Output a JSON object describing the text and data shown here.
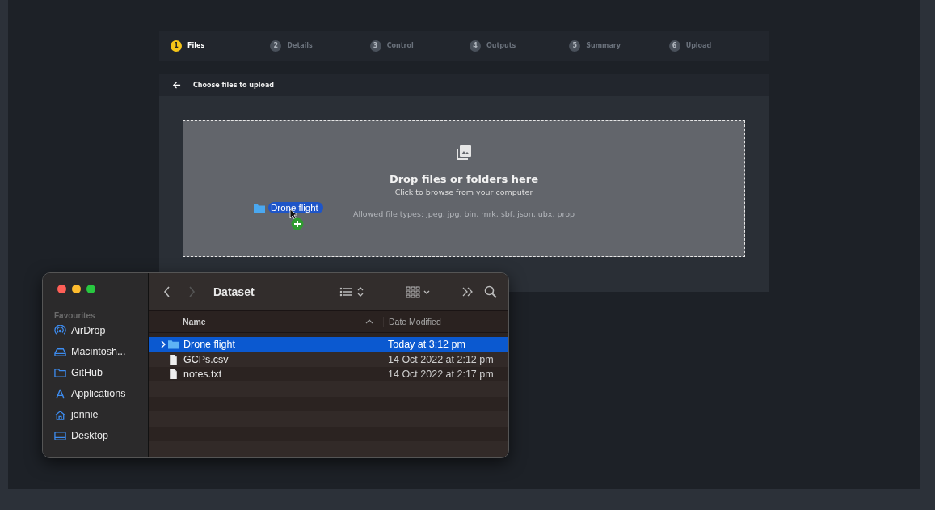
{
  "steps": [
    {
      "number": "1",
      "label": "Files",
      "selected": true
    },
    {
      "number": "2",
      "label": "Details",
      "selected": false
    },
    {
      "number": "3",
      "label": "Control",
      "selected": false
    },
    {
      "number": "4",
      "label": "Outputs",
      "selected": false
    },
    {
      "number": "5",
      "label": "Summary",
      "selected": false
    },
    {
      "number": "6",
      "label": "Upload",
      "selected": false
    }
  ],
  "header": {
    "title": "Choose files to upload"
  },
  "dropzone": {
    "title": "Drop files or folders here",
    "subtitle": "Click to browse from your computer",
    "allowed": "Allowed file types: jpeg, jpg, bin, mrk, sbf, json, ubx, prop"
  },
  "drag_item": {
    "label": "Drone flight"
  },
  "finder": {
    "title": "Dataset",
    "sidebar_heading": "Favourites",
    "sidebar_items": [
      {
        "label": "AirDrop",
        "kind": "airdrop"
      },
      {
        "label": "Macintosh...",
        "kind": "drive"
      },
      {
        "label": "GitHub",
        "kind": "folder"
      },
      {
        "label": "Applications",
        "kind": "apps"
      },
      {
        "label": "jonnie",
        "kind": "home"
      },
      {
        "label": "Desktop",
        "kind": "desktop"
      }
    ],
    "columns": [
      "Name",
      "Date Modified"
    ],
    "rows": [
      {
        "name": "Drone flight",
        "date": "Today at 3:12 pm",
        "kind": "folder",
        "selected": true
      },
      {
        "name": "GCPs.csv",
        "date": "14 Oct 2022 at 2:12 pm",
        "kind": "file",
        "selected": false
      },
      {
        "name": "notes.txt",
        "date": "14 Oct 2022 at 2:17 pm",
        "kind": "file",
        "selected": false
      }
    ]
  }
}
